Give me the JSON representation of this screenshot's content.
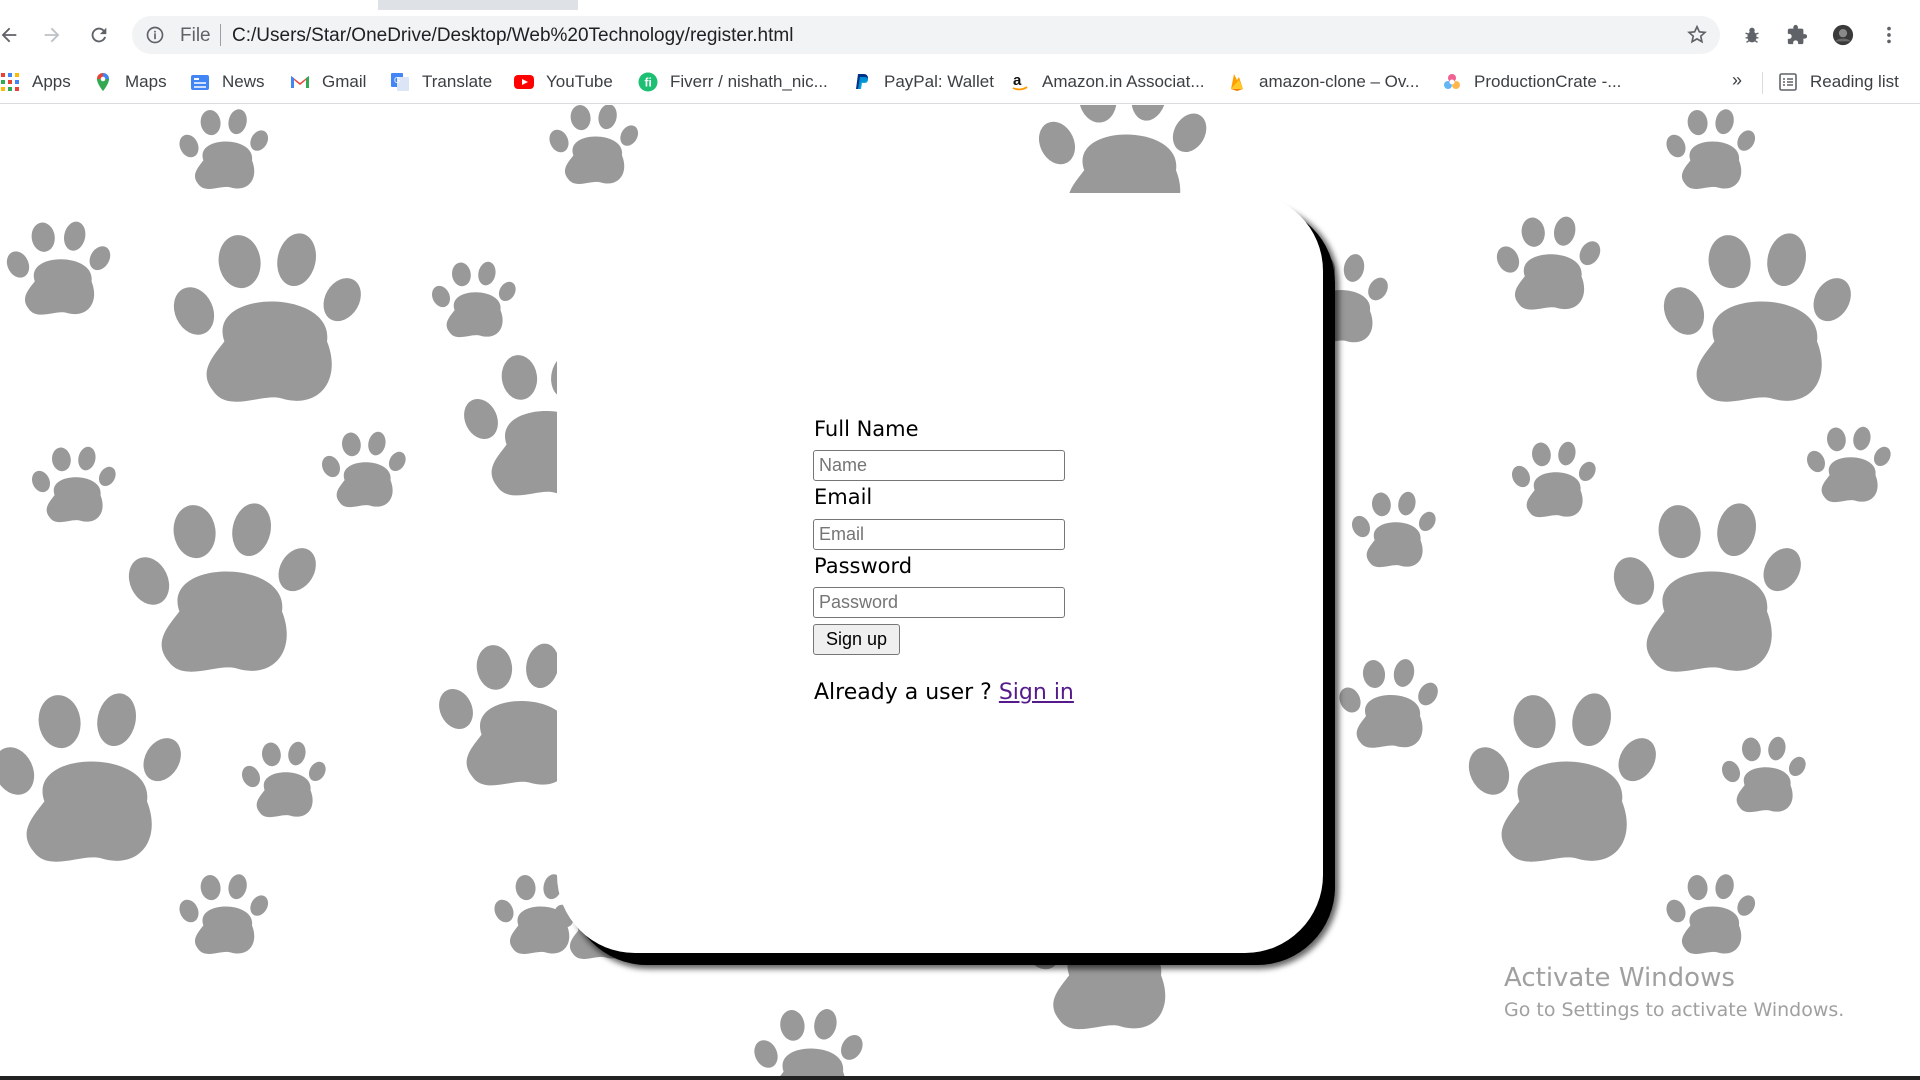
{
  "browser": {
    "address_scheme": "File",
    "address_url": "C:/Users/Star/OneDrive/Desktop/Web%20Technology/register.html",
    "bookmarks": [
      {
        "label": "Apps",
        "icon": "apps-grid-icon"
      },
      {
        "label": "Maps",
        "icon": "maps-pin-icon"
      },
      {
        "label": "News",
        "icon": "news-icon"
      },
      {
        "label": "Gmail",
        "icon": "gmail-icon"
      },
      {
        "label": "Translate",
        "icon": "translate-icon"
      },
      {
        "label": "YouTube",
        "icon": "youtube-icon"
      },
      {
        "label": "Fiverr / nishath_nic...",
        "icon": "fiverr-icon"
      },
      {
        "label": "PayPal: Wallet",
        "icon": "paypal-icon"
      },
      {
        "label": "Amazon.in Associat...",
        "icon": "amazon-icon"
      },
      {
        "label": "amazon-clone – Ov...",
        "icon": "firebase-icon"
      },
      {
        "label": "ProductionCrate -...",
        "icon": "productioncrate-icon"
      }
    ],
    "more_bookmarks": "»",
    "reading_list": "Reading list"
  },
  "form": {
    "name_label": "Full Name",
    "name_placeholder": "Name",
    "email_label": "Email",
    "email_placeholder": "Email",
    "password_label": "Password",
    "password_placeholder": "Password",
    "signup_button": "Sign up",
    "already_text": "Already a user ? ",
    "signin_link": "Sign in"
  },
  "watermark": {
    "line1": "Activate Windows",
    "line2": "Go to Settings to activate Windows."
  },
  "colors": {
    "paw": "#999999",
    "link": "#551a8b",
    "card_shadow": "#000000"
  }
}
